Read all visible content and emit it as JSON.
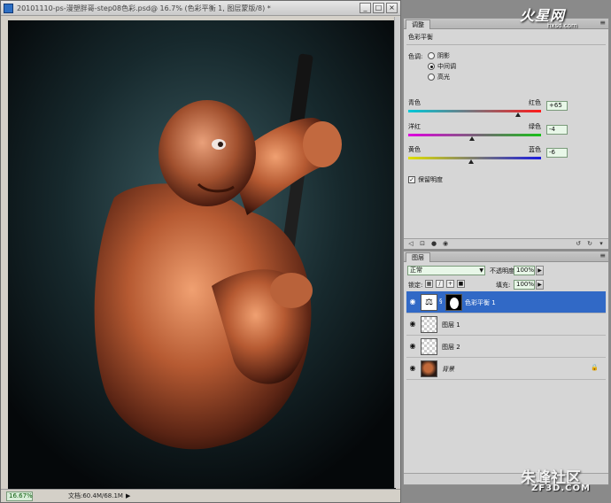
{
  "document": {
    "title": "20101110-ps-漫塑胖哥-step08色彩.psd@ 16.7% (色彩平衡 1, 图层蒙版/8) *",
    "zoom": "16.67%",
    "doc_info": "文档:60.4M/68.1M",
    "window_controls": {
      "minimize": "_",
      "maximize": "□",
      "close": "×"
    }
  },
  "adjustments": {
    "tab": "调整",
    "adjustment_name": "色彩平衡",
    "tone_label": "色调:",
    "tones": [
      {
        "label": "阴影",
        "checked": false
      },
      {
        "label": "中间调",
        "checked": true
      },
      {
        "label": "高光",
        "checked": false
      }
    ],
    "sliders": [
      {
        "left": "青色",
        "right": "红色",
        "value": "+65",
        "level": 0.825,
        "gradient": [
          "#00c8d8",
          "#ff1a1a"
        ]
      },
      {
        "left": "洋红",
        "right": "绿色",
        "value": "-4",
        "level": 0.48,
        "gradient": [
          "#e000e0",
          "#18c018"
        ]
      },
      {
        "left": "黄色",
        "right": "蓝色",
        "value": "-6",
        "level": 0.47,
        "gradient": [
          "#e0e000",
          "#1a1ae0"
        ]
      }
    ],
    "preserve_luminosity": {
      "label": "保留明度",
      "checked": true
    }
  },
  "layers": {
    "tab": "图层",
    "blend_mode": "正常",
    "opacity_label": "不透明度:",
    "opacity": "100%",
    "lock_label": "锁定:",
    "fill_label": "填充:",
    "fill": "100%",
    "items": [
      {
        "name": "色彩平衡 1",
        "type": "adjustment",
        "selected": true
      },
      {
        "name": "图层 1",
        "type": "pixel",
        "selected": false
      },
      {
        "name": "图层 2",
        "type": "pixel",
        "selected": false
      },
      {
        "name": "背景",
        "type": "photo",
        "selected": false,
        "locked": true
      }
    ]
  },
  "watermarks": {
    "top": "火星网",
    "top_sub": "hxsd.com",
    "bottom": "朱峰社区",
    "bottom_sub": "ZF3D.COM"
  }
}
